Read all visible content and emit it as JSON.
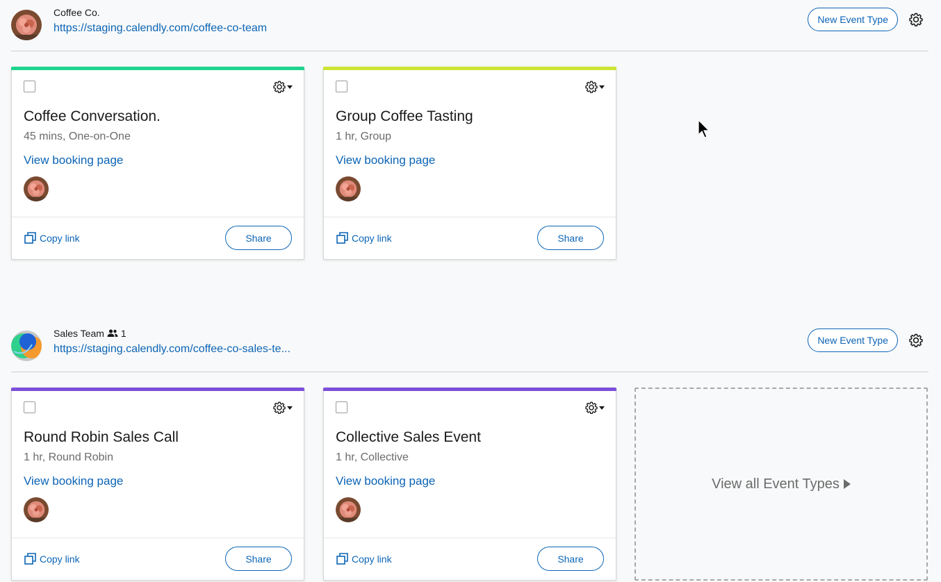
{
  "teams": [
    {
      "name": "Coffee Co.",
      "url": "https://staging.calendly.com/coffee-co-team",
      "member_count": "",
      "new_event_label": "New Event Type",
      "cards": [
        {
          "title": "Coffee Conversation.",
          "meta": "45 mins, One-on-One",
          "color": "#1fd48f",
          "booking_label": "View booking page",
          "copy_label": "Copy link",
          "share_label": "Share"
        },
        {
          "title": "Group Coffee Tasting",
          "meta": "1 hr, Group",
          "color": "#cde534",
          "booking_label": "View booking page",
          "copy_label": "Copy link",
          "share_label": "Share"
        }
      ]
    },
    {
      "name": "Sales Team",
      "url": "https://staging.calendly.com/coffee-co-sales-te...",
      "member_count": "1",
      "new_event_label": "New Event Type",
      "cards": [
        {
          "title": "Round Robin Sales Call",
          "meta": "1 hr, Round Robin",
          "color": "#7b4fd9",
          "booking_label": "View booking page",
          "copy_label": "Copy link",
          "share_label": "Share"
        },
        {
          "title": "Collective Sales Event",
          "meta": "1 hr, Collective",
          "color": "#7b4fd9",
          "booking_label": "View booking page",
          "copy_label": "Copy link",
          "share_label": "Share"
        }
      ],
      "view_all_label": "View all Event Types"
    }
  ],
  "colors": {
    "link": "#0b64b5",
    "page_bg": "#f8f9fa"
  },
  "icons": [
    "gear-icon",
    "copy-icon",
    "people-icon",
    "caret-down-icon",
    "play-icon",
    "cursor-icon"
  ]
}
